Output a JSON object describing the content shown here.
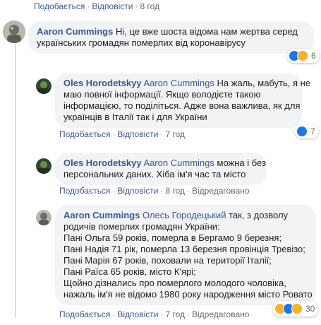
{
  "top_actions": {
    "like": "Подобається",
    "reply": "Відповісти",
    "time": "8 год"
  },
  "comments": [
    {
      "author": "Aaron Cummings",
      "lines": [
        "Ні, це вже шоста відома нам жертва серед",
        "українських громадян померлих від коронавірусу"
      ],
      "reaction_count": "6"
    },
    {
      "author": "Oles Horodetskyy",
      "mention": "Aaron Cummings",
      "first_line_rest": "На жаль, мабуть, я не",
      "lines": [
        "маю повної інформації. Якщо володієте такою",
        "інформацією, то поділіться. Адже вона важлива, як для",
        "українців в Італії так і для України"
      ],
      "actions": {
        "like": "Подобається",
        "reply": "Відповісти",
        "time": "7 год"
      },
      "reaction_count": "7"
    },
    {
      "author": "Oles Horodetskyy",
      "mention": "Aaron Cummings",
      "first_line_rest": "можна і без",
      "lines": [
        "персональних даних. Хіба ім'я час та місто"
      ],
      "actions": {
        "like": "Подобається",
        "reply": "Відповісти",
        "time": "8 год",
        "edited": "Відредаговано"
      }
    },
    {
      "author": "Aaron Cummings",
      "mention": "Олесь Городецький",
      "first_line_rest": "так, з дозволу",
      "lines": [
        "родичів померлих громадян України:",
        "Пані Ольга 59 років, померла в Бергамо 9 березня;",
        "Пані Надія 71 рік, померла 13 березня провінція Тревізо;",
        "Пані Марія 67 років, поховали на території Італії;",
        "Пані Раїса 65 років, місто К'ярі;",
        "Щойно дізнались про померлого молодого чоловіка,",
        "нажаль ім'я не відомо 1980 року народження місто Ровато"
      ],
      "actions": {
        "like": "Подобається",
        "reply": "Відповісти",
        "time": "7 год",
        "edited": "Відредаговано"
      },
      "reaction_count": "30"
    }
  ]
}
